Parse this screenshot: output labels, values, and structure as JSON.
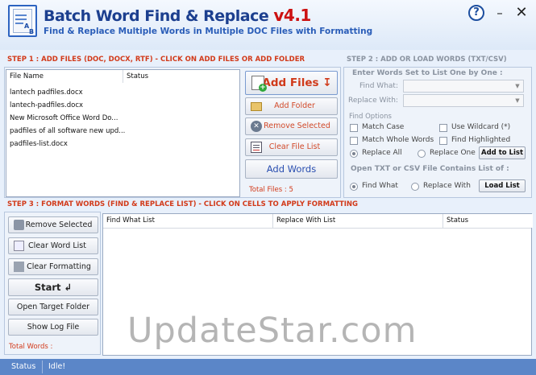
{
  "app": {
    "title": "Batch Word Find & Replace",
    "version": "v4.1",
    "subtitle": "Find & Replace Multiple Words in Multiple DOC Files with Formatting"
  },
  "window_controls": {
    "help": "?",
    "minimize": "–",
    "close": "✕"
  },
  "step1": {
    "header": "STEP 1 : ADD FILES (DOC, DOCX, RTF) - CLICK ON ADD FILES OR ADD FOLDER",
    "columns": [
      "File Name",
      "Status"
    ],
    "files": [
      "lantech padfiles.docx",
      "lantech-padfiles.docx",
      "New Microsoft Office Word Do...",
      "padfiles of all software new upd...",
      "padfiles-list.docx"
    ],
    "buttons": {
      "add_files": "Add Files ↧",
      "add_folder": "Add Folder",
      "remove_selected": "Remove Selected",
      "clear_file_list": "Clear File List",
      "add_words": "Add Words"
    },
    "total_files": "Total Files : 5"
  },
  "step2": {
    "header": "STEP 2 : ADD OR LOAD WORDS (TXT/CSV)",
    "group1": "Enter Words Set to List One by One :",
    "find_what_label": "Find What:",
    "replace_with_label": "Replace With:",
    "find_options_label": "Find Options",
    "options": {
      "match_case": "Match Case",
      "use_wildcard": "Use Wildcard (*)",
      "match_whole_words": "Match Whole Words",
      "find_highlighted": "Find Highlighted"
    },
    "replace_all": "Replace All",
    "replace_one": "Replace One",
    "add_to_list": "Add to List",
    "group2": "Open TXT or CSV File Contains List of :",
    "find_what_radio": "Find What",
    "replace_with_radio": "Replace With",
    "load_list": "Load List"
  },
  "step3": {
    "header": "STEP 3 : FORMAT WORDS (FIND & REPLACE LIST) - CLICK ON CELLS TO APPLY FORMATTING",
    "buttons": {
      "remove_selected": "Remove Selected",
      "clear_word_list": "Clear Word List",
      "clear_formatting": "Clear Formatting",
      "start": "Start ↲",
      "open_target_folder": "Open Target Folder",
      "show_log_file": "Show Log File"
    },
    "total_words": "Total Words :",
    "columns": [
      "Find What List",
      "Replace With List",
      "Status"
    ]
  },
  "statusbar": {
    "label": "Status",
    "value": "Idle!"
  },
  "watermark": "UpdateStar.com"
}
